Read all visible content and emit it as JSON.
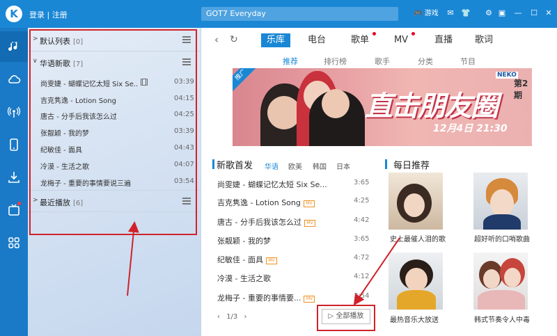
{
  "topbar": {
    "logo": "K",
    "login": "登录",
    "sep": "|",
    "register": "注册",
    "search_value": "GOT7 Everyday",
    "game": "游戏"
  },
  "sidebar": {
    "sections": [
      {
        "name": "默认列表",
        "count": "[0]"
      },
      {
        "name": "华语新歌",
        "count": "[7]"
      },
      {
        "name": "最近播放",
        "count": "[6]"
      }
    ],
    "songs": [
      {
        "title": "尚雯婕 - 蝴蝶记忆太短 Six Se...",
        "duration": "03:39",
        "mv": true
      },
      {
        "title": "吉克隽逸 - Lotion Song",
        "duration": "04:15",
        "mv": false
      },
      {
        "title": "唐古 - 分手后我该怎么过",
        "duration": "04:25",
        "mv": false
      },
      {
        "title": "张靓颖 - 我的梦",
        "duration": "03:39",
        "mv": false
      },
      {
        "title": "纪敏佳 - 面具",
        "duration": "04:43",
        "mv": false
      },
      {
        "title": "冷漠 - 生活之歌",
        "duration": "04:07",
        "mv": false
      },
      {
        "title": "龙梅子 - 重要的事情要说三遍",
        "duration": "03:54",
        "mv": false
      }
    ]
  },
  "main": {
    "tabs": [
      "乐库",
      "电台",
      "歌单",
      "MV",
      "直播",
      "歌词"
    ],
    "subtabs": [
      "推荐",
      "排行榜",
      "歌手",
      "分类",
      "节目"
    ],
    "banner": {
      "ad": "推广",
      "title": "直击朋友圈",
      "when": "12月4日 21:30",
      "episode": "第2期",
      "brand": "NEKO"
    },
    "new_songs": {
      "title": "新歌首发",
      "langs": [
        "华语",
        "欧美",
        "韩国",
        "日本"
      ],
      "mv_tag": "MV",
      "songs": [
        {
          "title": "尚雯婕 - 蝴蝶记忆太短 Six Se...",
          "duration": "3:65",
          "mv": false
        },
        {
          "title": "吉克隽逸 - Lotion Song",
          "duration": "4:25",
          "mv": true
        },
        {
          "title": "唐古 - 分手后我该怎么过",
          "duration": "4:42",
          "mv": true
        },
        {
          "title": "张靓颖 - 我的梦",
          "duration": "3:65",
          "mv": false
        },
        {
          "title": "纪敏佳 - 面具",
          "duration": "4:72",
          "mv": true
        },
        {
          "title": "冷漠 - 生活之歌",
          "duration": "4:12",
          "mv": false
        },
        {
          "title": "龙梅子 - 重要的事情要...",
          "duration": "3:54",
          "mv": true
        }
      ],
      "pager": "1/3",
      "play_all": "全部播放"
    },
    "daily": {
      "title": "每日推荐",
      "items": [
        "史上最催人泪的歌",
        "超好听的口哨歌曲",
        "最热音乐大放送",
        "韩式节奏令人中毒"
      ]
    }
  },
  "colors": {
    "brand": "#1a87d5",
    "highlight": "#d0222a",
    "mv_tag": "#f09020"
  }
}
